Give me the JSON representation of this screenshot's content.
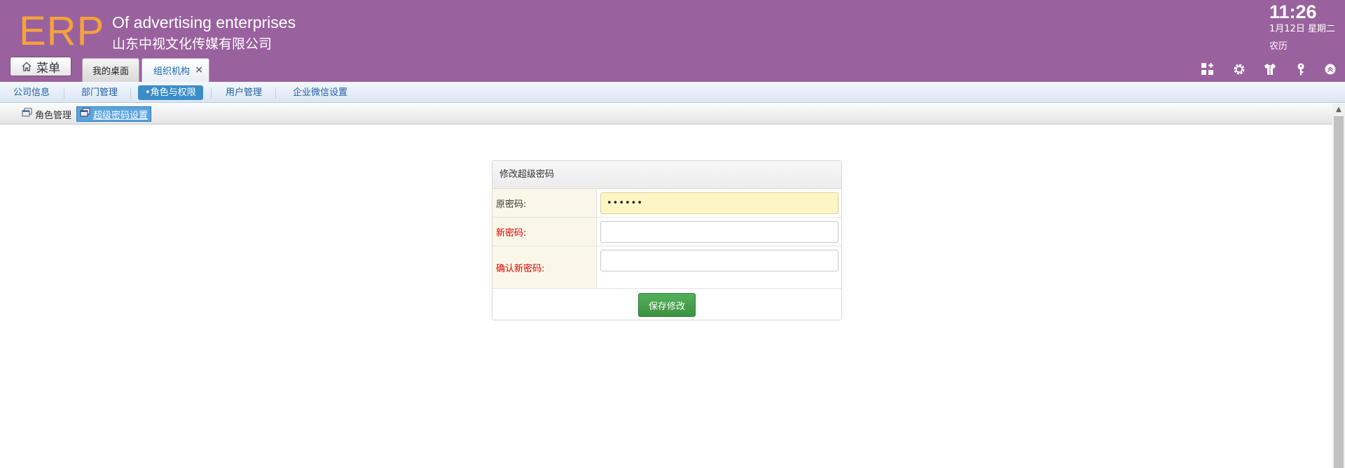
{
  "header": {
    "logo": "ERP",
    "company_en": "Of advertising enterprises",
    "company_cn": "山东中视文化传媒有限公司",
    "menu_button": "菜单",
    "tabs": [
      {
        "label": "我的桌面"
      },
      {
        "label": "组织机构",
        "close": "×"
      }
    ],
    "clock": {
      "time": "11:26",
      "date": "1月12日 星期二",
      "lunar": "农历"
    },
    "icons": [
      "grid-plus-icon",
      "gear-icon",
      "shirt-icon",
      "key-icon",
      "collapse-up-icon"
    ]
  },
  "nav": {
    "items": [
      {
        "label": "公司信息"
      },
      {
        "label": "部门管理"
      },
      {
        "label": "•角色与权限",
        "active": true
      },
      {
        "label": "用户管理"
      },
      {
        "label": "企业微信设置"
      }
    ]
  },
  "subtabs": [
    {
      "label": "角色管理"
    },
    {
      "label": "超级密码设置",
      "active": true
    }
  ],
  "form": {
    "title": "修改超级密码",
    "fields": [
      {
        "label": "原密码:",
        "value": "••••••",
        "required": false
      },
      {
        "label": "新密码:",
        "value": "",
        "required": true
      },
      {
        "label": "确认新密码:",
        "value": "",
        "required": true
      }
    ],
    "submit": "保存修改"
  },
  "colors": {
    "header_bg": "#99619d",
    "logo": "#f5a23a",
    "nav_active": "#3b8dc9",
    "required_label": "#e00000",
    "save_button": "#48a04e"
  }
}
